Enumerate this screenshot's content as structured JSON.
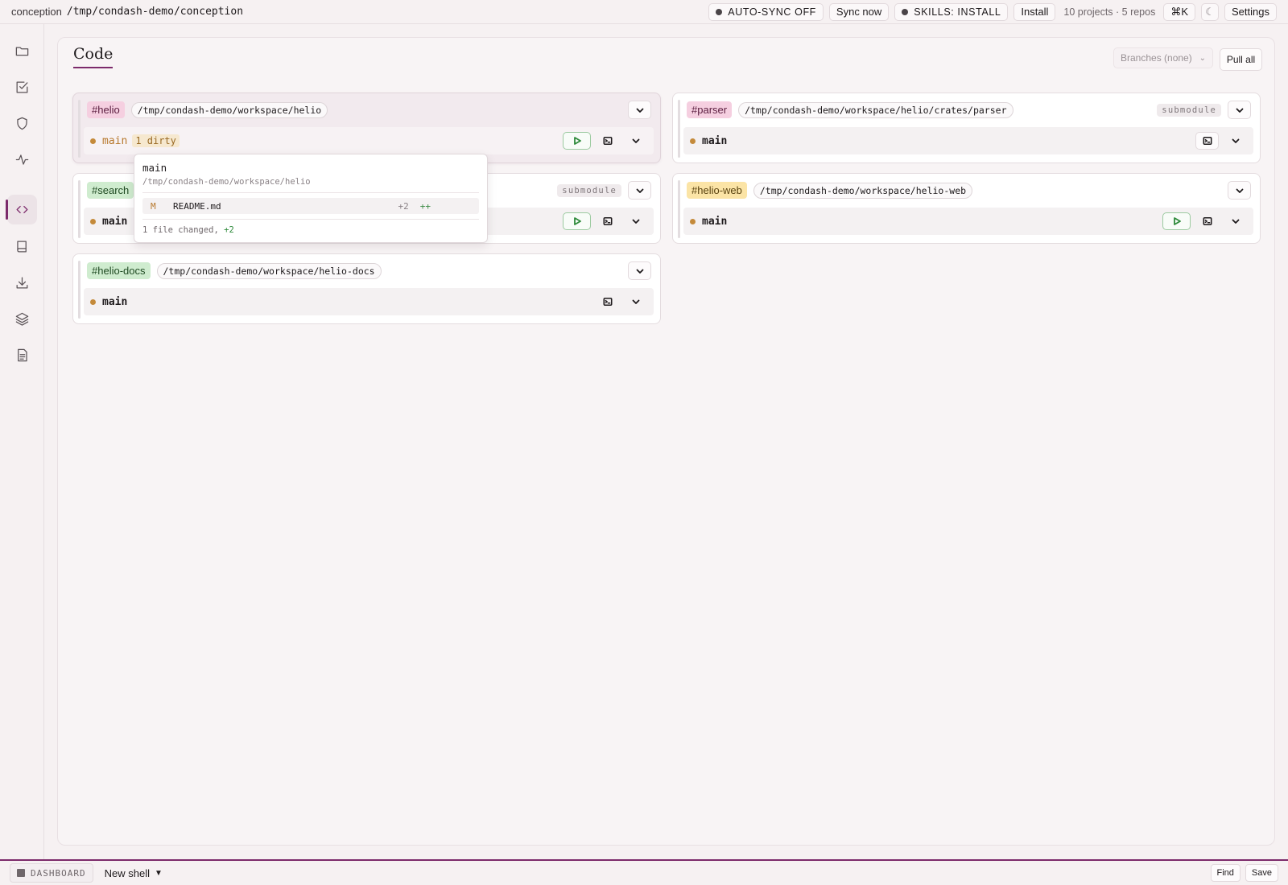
{
  "topbar": {
    "app_name": "conception",
    "path": "/tmp/condash-demo/conception",
    "autosync_label": "AUTO-SYNC OFF",
    "sync_now_label": "Sync now",
    "skills_label": "SKILLS: INSTALL",
    "install_label": "Install",
    "counts": "10 projects · 5 repos",
    "shortcut_label": "⌘K",
    "theme_icon": "☾",
    "settings_label": "Settings"
  },
  "rail": {
    "items": [
      "folder-icon",
      "checklist-icon",
      "shield-icon",
      "activity-icon",
      "code-icon",
      "book-icon",
      "download-icon",
      "layers-icon",
      "document-icon"
    ],
    "active": "code-icon"
  },
  "panel": {
    "title": "Code",
    "branches_select": "Branches (none)",
    "pull_all_label": "Pull all"
  },
  "repos": [
    {
      "tag": "#helio",
      "path": "/tmp/condash-demo/workspace/helio",
      "branch": "main",
      "dirty": "1 dirty"
    },
    {
      "tag": "#parser",
      "path": "/tmp/condash-demo/workspace/helio/crates/parser",
      "badge": "submodule",
      "branch": "main"
    },
    {
      "tag": "#search",
      "badge": "submodule",
      "branch": "main"
    },
    {
      "tag": "#helio-web",
      "path": "/tmp/condash-demo/workspace/helio-web",
      "branch": "main"
    },
    {
      "tag": "#helio-docs",
      "path": "/tmp/condash-demo/workspace/helio-docs",
      "branch": "main"
    }
  ],
  "popover": {
    "branch": "main",
    "path": "/tmp/condash-demo/workspace/helio",
    "file_status": "M",
    "file_name": "README.md",
    "file_additions": "+2",
    "file_bars": "++",
    "summary": "1 file changed,",
    "summary_additions": "+2"
  },
  "statusbar": {
    "dashboard_label": "DASHBOARD",
    "new_shell_label": "New shell",
    "new_shell_caret": "▼",
    "find_label": "Find",
    "save_label": "Save"
  },
  "colors": {
    "accent": "#7c2a6b",
    "tag_pink": "#f5cfe0",
    "tag_green": "#cfeccf",
    "tag_yellow": "#fbe4a6",
    "branch_dot": "#c48a3a",
    "run_green": "#2e8a3a"
  }
}
